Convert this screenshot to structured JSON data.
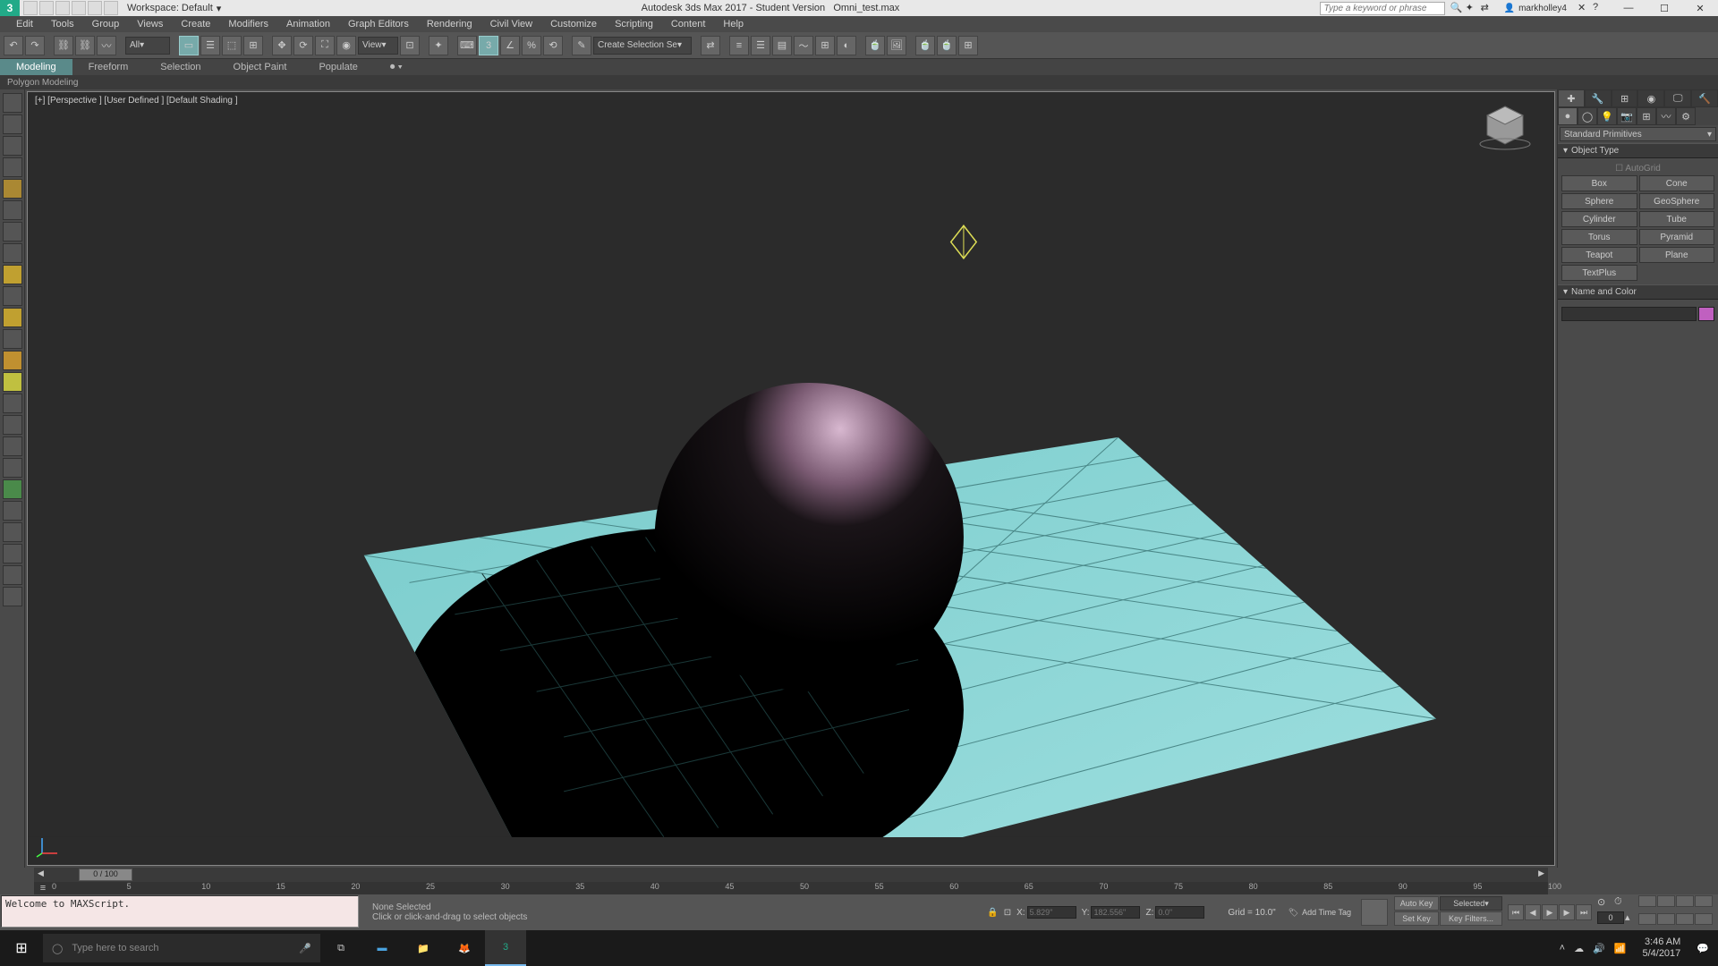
{
  "app": {
    "title": "Autodesk 3ds Max 2017 - Student Version",
    "filename": "Omni_test.max",
    "workspace_label": "Workspace: Default",
    "search_placeholder": "Type a keyword or phrase",
    "username": "markholley4"
  },
  "menus": [
    "Edit",
    "Tools",
    "Group",
    "Views",
    "Create",
    "Modifiers",
    "Animation",
    "Graph Editors",
    "Rendering",
    "Civil View",
    "Customize",
    "Scripting",
    "Content",
    "Help"
  ],
  "toolbar": {
    "filter_label": "All",
    "view_label": "View",
    "named_sel": "Create Selection Se"
  },
  "ribbon": {
    "tabs": [
      "Modeling",
      "Freeform",
      "Selection",
      "Object Paint",
      "Populate"
    ],
    "active": 0,
    "sub": "Polygon Modeling"
  },
  "viewport": {
    "label": "[+] [Perspective ] [User Defined ] [Default Shading ]"
  },
  "cmd": {
    "category": "Standard Primitives",
    "rollout_objtype": "Object Type",
    "autogrid": "AutoGrid",
    "objects": [
      "Box",
      "Cone",
      "Sphere",
      "GeoSphere",
      "Cylinder",
      "Tube",
      "Torus",
      "Pyramid",
      "Teapot",
      "Plane",
      "TextPlus",
      ""
    ],
    "rollout_name": "Name and Color",
    "name_value": "",
    "color": "#c060c0"
  },
  "time": {
    "slider_label": "0 / 100",
    "ticks": [
      0,
      5,
      10,
      15,
      20,
      25,
      30,
      35,
      40,
      45,
      50,
      55,
      60,
      65,
      70,
      75,
      80,
      85,
      90,
      95,
      100
    ]
  },
  "status": {
    "script": "Welcome to MAXScript.",
    "sel": "None Selected",
    "prompt": "Click or click-and-drag to select objects",
    "x": "5.829\"",
    "y": "182.556\"",
    "z": "0.0\"",
    "grid": "Grid = 10.0\"",
    "addtime": "Add Time Tag",
    "autokey": "Auto Key",
    "setkey": "Set Key",
    "selected": "Selected",
    "keyfilters": "Key Filters...",
    "frame": "0"
  },
  "taskbar": {
    "search": "Type here to search",
    "time": "3:46 AM",
    "date": "5/4/2017"
  }
}
